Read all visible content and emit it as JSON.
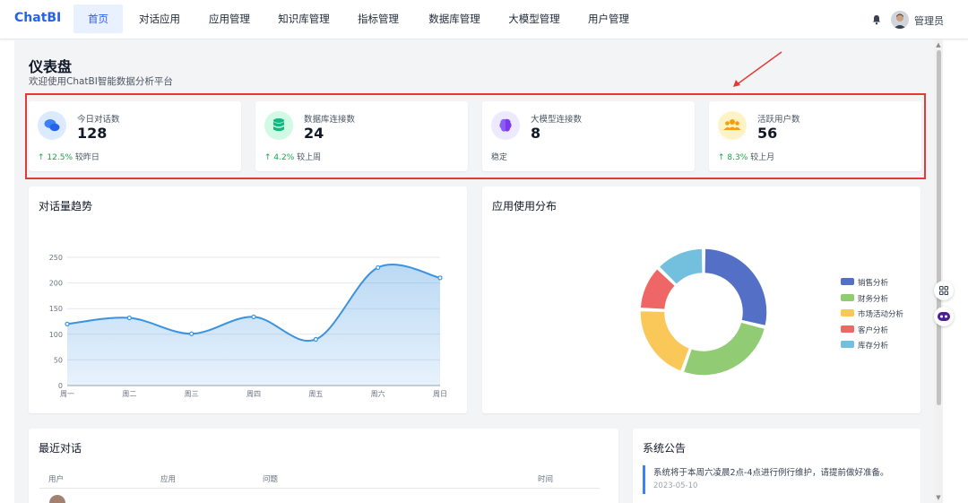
{
  "nav": {
    "brand": "ChatBI",
    "items": [
      "首页",
      "对话应用",
      "应用管理",
      "知识库管理",
      "指标管理",
      "数据库管理",
      "大模型管理",
      "用户管理"
    ],
    "active_index": 0,
    "user_name": "管理员"
  },
  "page": {
    "title": "仪表盘",
    "subtitle": "欢迎使用ChatBI智能数据分析平台"
  },
  "stats": [
    {
      "label": "今日对话数",
      "value": "128",
      "trend": "↑ 12.5%",
      "note": "较昨日",
      "icon": "chat-bubbles-icon",
      "color": "#3b82f6",
      "bg": "#dbeafe"
    },
    {
      "label": "数据库连接数",
      "value": "24",
      "trend": "↑ 4.2%",
      "note": "较上周",
      "icon": "database-icon",
      "color": "#10b981",
      "bg": "#d1fae5"
    },
    {
      "label": "大模型连接数",
      "value": "8",
      "trend": "",
      "note": "稳定",
      "icon": "brain-icon",
      "color": "#8b5cf6",
      "bg": "#ede9fe"
    },
    {
      "label": "活跃用户数",
      "value": "56",
      "trend": "↑ 8.3%",
      "note": "较上月",
      "icon": "users-icon",
      "color": "#f59e0b",
      "bg": "#fef3c7"
    }
  ],
  "trend_panel": {
    "title": "对话量趋势"
  },
  "pie_panel": {
    "title": "应用使用分布"
  },
  "chart_data": [
    {
      "type": "area",
      "title": "对话量趋势",
      "categories": [
        "周一",
        "周二",
        "周三",
        "周四",
        "周五",
        "周六",
        "周日"
      ],
      "values": [
        120,
        132,
        101,
        134,
        90,
        230,
        210
      ],
      "ylim": [
        0,
        250
      ],
      "yticks": [
        0,
        50,
        100,
        150,
        200,
        250
      ],
      "color": "#3b93e0"
    },
    {
      "type": "pie",
      "title": "应用使用分布",
      "categories": [
        "销售分析",
        "财务分析",
        "市场活动分析",
        "客户分析",
        "库存分析"
      ],
      "values": [
        335,
        310,
        234,
        135,
        148
      ],
      "colors": [
        "#5470c6",
        "#91cc75",
        "#fac858",
        "#ee6666",
        "#73c0de"
      ],
      "legend": "right"
    }
  ],
  "recent": {
    "title": "最近对话",
    "columns": [
      "用户",
      "应用",
      "问题",
      "时间"
    ]
  },
  "announcement": {
    "title": "系统公告",
    "items": [
      {
        "text": "系统将于本周六凌晨2点-4点进行例行维护，请提前做好准备。",
        "date": "2023-05-10"
      }
    ]
  }
}
